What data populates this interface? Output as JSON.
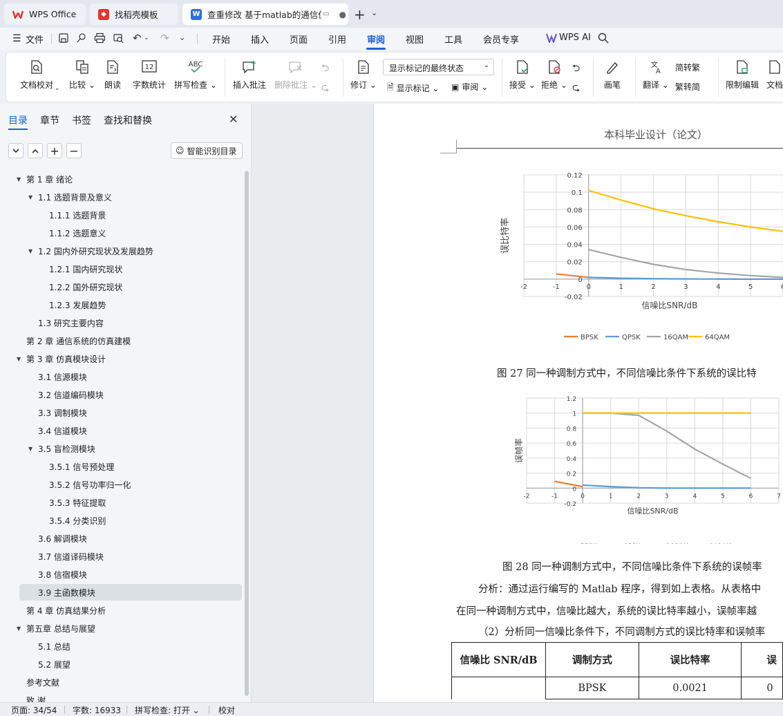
{
  "tabs": [
    {
      "label": "WPS Office"
    },
    {
      "label": "找稻壳模板"
    },
    {
      "label": "查重修改 基于matlab的通信仿"
    }
  ],
  "menu": [
    "文件",
    "开始",
    "插入",
    "页面",
    "引用",
    "审阅",
    "视图",
    "工具",
    "会员专享",
    "WPS AI"
  ],
  "active_menu": "审阅",
  "ribbon": {
    "doc_check": "文档校对",
    "compare": "比较",
    "read_aloud": "朗读",
    "word_count": "字数统计",
    "spell_check": "拼写检查",
    "insert_comment": "插入批注",
    "delete_comment": "删除批注",
    "track_changes": "修订",
    "markup_state": "显示标记的最终状态",
    "show_markup": "显示标记",
    "review": "审阅",
    "accept": "接受",
    "reject": "拒绝",
    "pen": "画笔",
    "translate": "翻译",
    "to_simplified": "简转繁",
    "to_traditional": "繁转简",
    "restrict_edit": "限制编辑",
    "doc_rights": "文档",
    "word_count_icon_text": "12",
    "spell_icon_text": "ABC"
  },
  "sidebar": {
    "tabs": [
      "目录",
      "章节",
      "书签",
      "查找和替换"
    ],
    "smart_toc": "智能识别目录",
    "toc": [
      {
        "text": "第 1 章  绪论",
        "level": 1,
        "expanded": true
      },
      {
        "text": "1.1 选题背景及意义",
        "level": 2,
        "expanded": true
      },
      {
        "text": "1.1.1 选题背景",
        "level": 3
      },
      {
        "text": "1.1.2 选题意义",
        "level": 3
      },
      {
        "text": "1.2 国内外研究现状及发展趋势",
        "level": 2,
        "expanded": true
      },
      {
        "text": "1.2.1 国内研究现状",
        "level": 3
      },
      {
        "text": "1.2.2 国外研究现状",
        "level": 3
      },
      {
        "text": "1.2.3 发展趋势",
        "level": 3
      },
      {
        "text": "1.3 研究主要内容",
        "level": 2
      },
      {
        "text": "第 2 章  通信系统的仿真建模",
        "level": 1
      },
      {
        "text": "第 3 章  仿真模块设计",
        "level": 1,
        "expanded": true
      },
      {
        "text": "3.1 信源模块",
        "level": 2
      },
      {
        "text": "3.2 信道编码模块",
        "level": 2
      },
      {
        "text": "3.3 调制模块",
        "level": 2
      },
      {
        "text": "3.4 信道模块",
        "level": 2
      },
      {
        "text": "3.5 盲检测模块",
        "level": 2,
        "expanded": true
      },
      {
        "text": "3.5.1 信号预处理",
        "level": 3
      },
      {
        "text": "3.5.2 信号功率归一化",
        "level": 3
      },
      {
        "text": "3.5.3 特征提取",
        "level": 3
      },
      {
        "text": "3.5.4 分类识别",
        "level": 3
      },
      {
        "text": "3.6  解调模块",
        "level": 2
      },
      {
        "text": "3.7 信道译码模块",
        "level": 2
      },
      {
        "text": "3.8 信宿模块",
        "level": 2
      },
      {
        "text": "3.9  主函数模块",
        "level": 2,
        "selected": true
      },
      {
        "text": "第 4 章  仿真结果分析",
        "level": 1
      },
      {
        "text": "第五章  总结与展望",
        "level": 1,
        "expanded": true
      },
      {
        "text": "5.1 总结",
        "level": 2
      },
      {
        "text": "5.2 展望",
        "level": 2
      },
      {
        "text": "参考文献",
        "level": 1
      },
      {
        "text": "致   谢",
        "level": 1
      }
    ]
  },
  "document": {
    "header": "本科毕业设计（论文）",
    "fig27_caption": "图 27    同一种调制方式中，不同信噪比条件下系统的误比特",
    "fig28_caption": "图 28    同一种调制方式中，不同信噪比条件下系统的误帧率",
    "para1": "分析：通过运行编写的 Matlab 程序，得到如上表格。从表格中",
    "para2": "在同一种调制方式中，信噪比越大，系统的误比特率越小，误帧率越",
    "para3": "（2）分析同一信噪比条件下，不同调制方式的误比特率和误帧率",
    "table_headers": [
      "信噪比 SNR/dB",
      "调制方式",
      "误比特率",
      "误"
    ],
    "table_row1": [
      "",
      "BPSK",
      "0.0021",
      "0"
    ]
  },
  "chart_data": [
    {
      "type": "line",
      "ylabel": "误比特率",
      "xlabel": "信噪比SNR/dB",
      "xlim": [
        -2,
        6
      ],
      "ylim": [
        -0.02,
        0.12
      ],
      "xticks": [
        "-2",
        "-1",
        "0",
        "1",
        "2",
        "3",
        "4",
        "5",
        "6"
      ],
      "yticks": [
        "-0.02",
        "0",
        "0.02",
        "0.04",
        "0.06",
        "0.08",
        "0.1",
        "0.12"
      ],
      "grid": true,
      "legend_position": "bottom",
      "series": [
        {
          "name": "BPSK",
          "color": "#ed7d31",
          "x": [
            -1,
            0
          ],
          "y": [
            0.006,
            0.002
          ]
        },
        {
          "name": "QPSK",
          "color": "#5b9bd5",
          "x": [
            0,
            1,
            2,
            3,
            4,
            5,
            6
          ],
          "y": [
            0.002,
            0.001,
            0.0005,
            0.0002,
            0.0001,
            0.0,
            0.0
          ]
        },
        {
          "name": "16QAM",
          "color": "#a5a5a5",
          "x": [
            0,
            1,
            2,
            3,
            4,
            5,
            6
          ],
          "y": [
            0.034,
            0.025,
            0.017,
            0.011,
            0.007,
            0.004,
            0.002
          ]
        },
        {
          "name": "64QAM",
          "color": "#ffc000",
          "x": [
            0,
            1,
            2,
            3,
            4,
            5,
            6
          ],
          "y": [
            0.102,
            0.091,
            0.081,
            0.073,
            0.066,
            0.06,
            0.055
          ]
        }
      ]
    },
    {
      "type": "line",
      "ylabel": "误帧率",
      "xlabel": "信噪比SNR/dB",
      "xlim": [
        -2,
        7
      ],
      "ylim": [
        -0.2,
        1.2
      ],
      "xticks": [
        "-2",
        "-1",
        "0",
        "1",
        "2",
        "3",
        "4",
        "5",
        "6",
        "7"
      ],
      "yticks": [
        "-0.2",
        "0",
        "0.2",
        "0.4",
        "0.6",
        "0.8",
        "1",
        "1.2"
      ],
      "grid": true,
      "legend_position": "bottom",
      "series": [
        {
          "name": "BPSK",
          "color": "#ed7d31",
          "x": [
            -1,
            0
          ],
          "y": [
            0.09,
            0.02
          ]
        },
        {
          "name": "QPSK",
          "color": "#5b9bd5",
          "x": [
            0,
            1,
            2,
            3,
            4,
            5,
            6
          ],
          "y": [
            0.04,
            0.02,
            0.005,
            0.0,
            0.0,
            0.0,
            0.0
          ]
        },
        {
          "name": "16QAM",
          "color": "#a5a5a5",
          "x": [
            0,
            1,
            2,
            3,
            4,
            5,
            6
          ],
          "y": [
            1.0,
            1.0,
            0.97,
            0.76,
            0.52,
            0.32,
            0.13
          ]
        },
        {
          "name": "64QAM",
          "color": "#ffc000",
          "x": [
            0,
            1,
            2,
            3,
            4,
            5,
            6
          ],
          "y": [
            1.0,
            1.0,
            1.0,
            1.0,
            1.0,
            1.0,
            1.0
          ]
        }
      ]
    }
  ],
  "status": {
    "page": "页面: 34/54",
    "words": "字数: 16933",
    "spell": "拼写检查: 打开",
    "proof": "校对"
  }
}
